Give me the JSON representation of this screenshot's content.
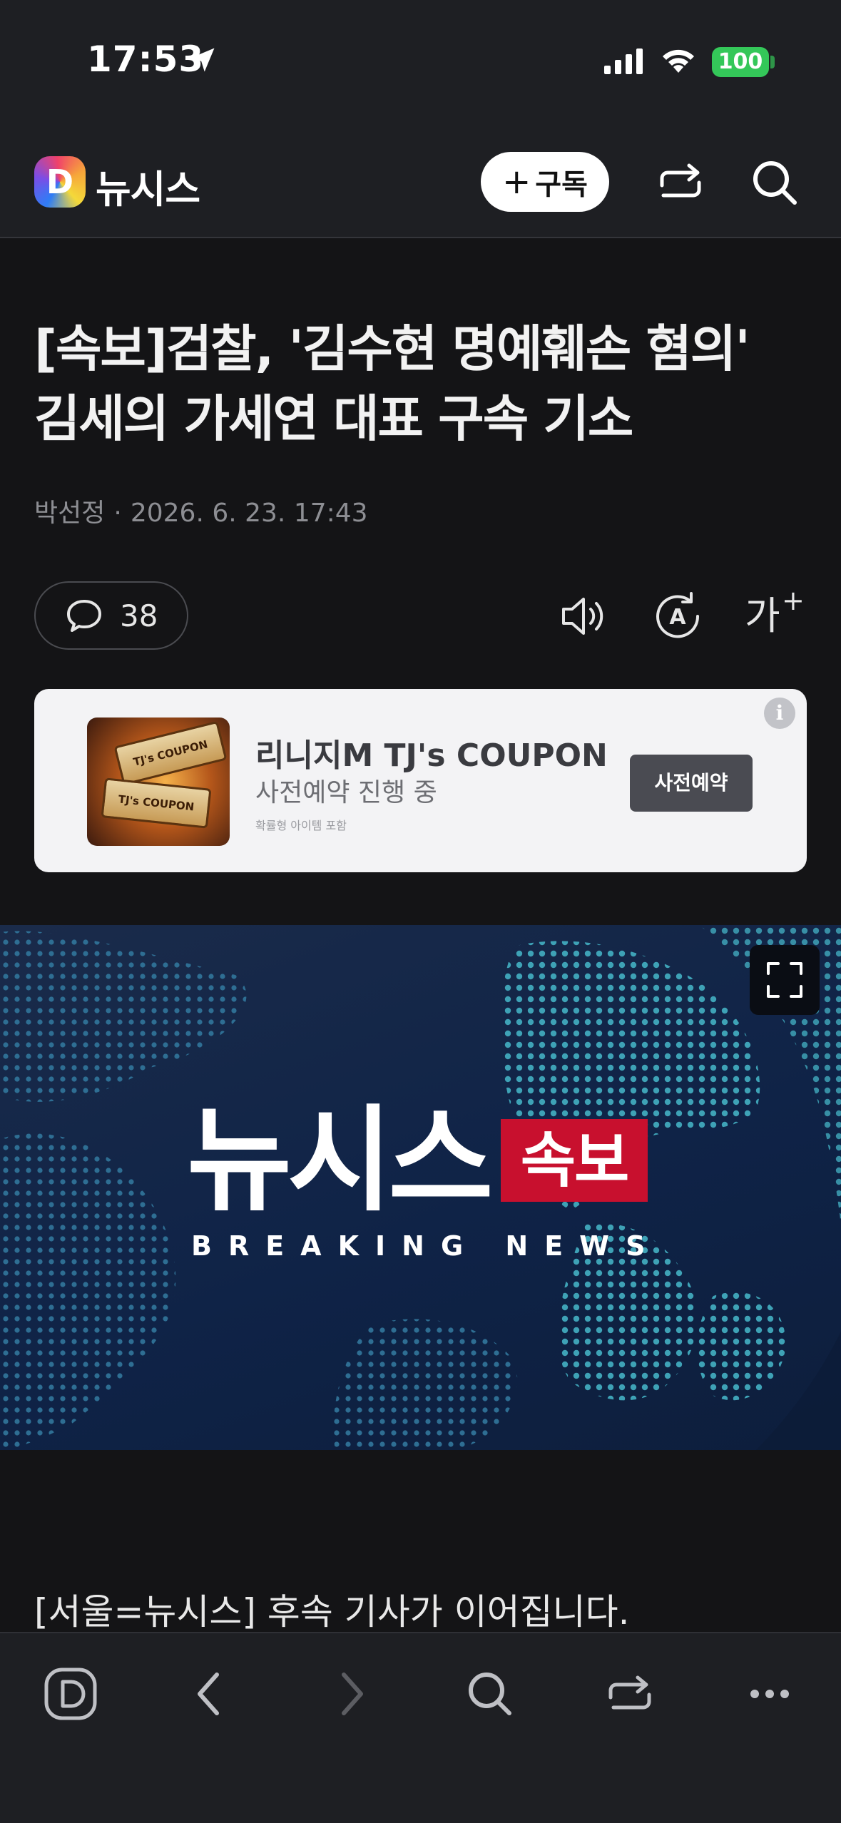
{
  "status_bar": {
    "time": "17:53",
    "battery": "100"
  },
  "header": {
    "brand_initial": "D",
    "brand_name": "뉴시스",
    "subscribe_label": "구독"
  },
  "article": {
    "headline_line1": "[속보]검찰, '김수현 명예훼손 혐의'",
    "headline_line2": "김세의 가세연 대표 구속 기소",
    "author": "박선정",
    "separator": "·",
    "datetime": "2026. 6. 23. 17:43",
    "comment_count": "38",
    "body": "[서울=뉴시스] 후속 기사가 이어집니다."
  },
  "toolbar_right": {
    "font_size_label": "가"
  },
  "ad": {
    "title": "리니지M TJ's COUPON",
    "subtitle": "사전예약 진행 중",
    "note": "확률형 아이템 포함",
    "cta": "사전예약",
    "info": "i",
    "coupon_text": "TJ's COUPON"
  },
  "hero": {
    "brand": "뉴시스",
    "badge": "속보",
    "subtitle": "BREAKING NEWS"
  },
  "colors": {
    "accent_green": "#34c759",
    "badge_red": "#c8102e",
    "bg": "#141416"
  },
  "icons": {
    "header": [
      "share-icon",
      "search-icon"
    ],
    "actions": [
      "speaker-icon",
      "translate-icon",
      "font-size-icon"
    ],
    "bottom": [
      "home-d-icon",
      "back-icon",
      "forward-icon",
      "search-icon",
      "share-icon",
      "more-icon"
    ]
  }
}
